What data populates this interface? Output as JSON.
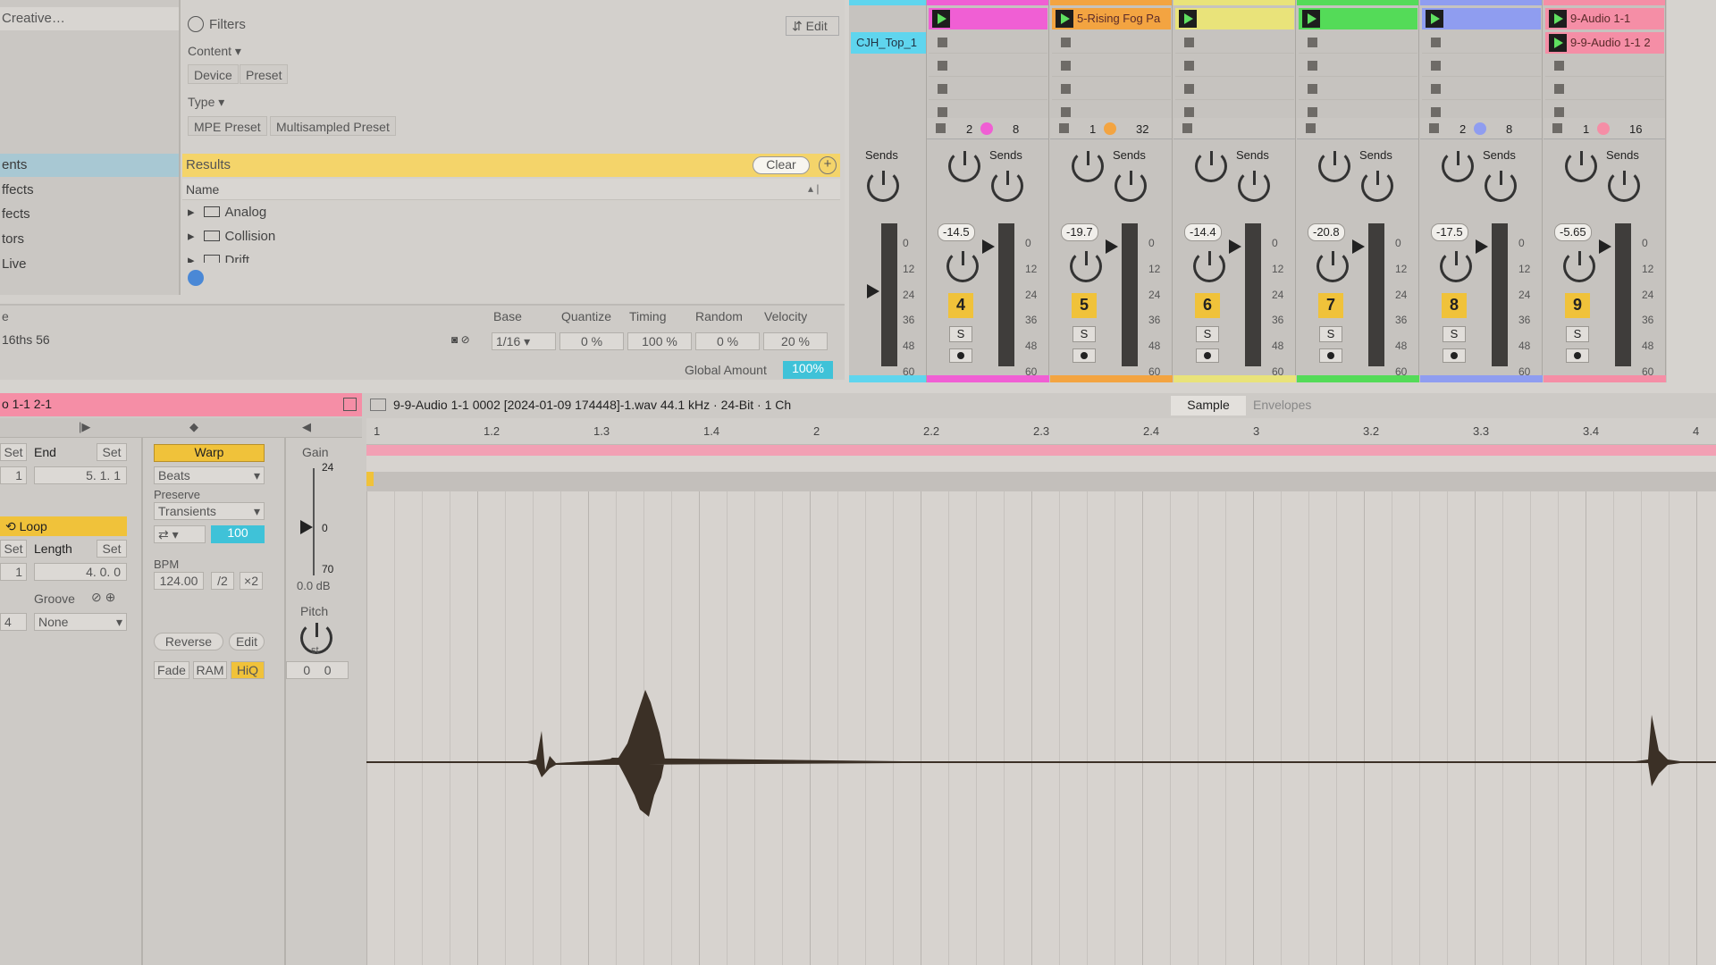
{
  "browser": {
    "sidebar_items": [
      "Creative…",
      "ents",
      "ffects",
      "fects",
      "tors",
      "Live"
    ],
    "filters_label": "Filters",
    "edit_label": "Edit",
    "content_label": "Content",
    "type_label": "Type",
    "chips": [
      "Device",
      "Preset",
      "MPE Preset",
      "Multisampled Preset"
    ],
    "results_label": "Results",
    "clear_label": "Clear",
    "name_header": "Name",
    "folders": [
      "Analog",
      "Collision",
      "Drift"
    ]
  },
  "groove": {
    "row_label": "e",
    "groove_name": "16ths 56",
    "headers": [
      "Base",
      "Quantize",
      "Timing",
      "Random",
      "Velocity"
    ],
    "values": [
      "1/16",
      "0 %",
      "100 %",
      "0 %",
      "20 %"
    ],
    "global_label": "Global Amount",
    "global_value": "100%"
  },
  "mixer": {
    "clips": [
      {
        "name": "CJH_Top_1",
        "color": "#5fd5ee"
      },
      {
        "name": "",
        "color": "#f05fd4"
      },
      {
        "name": "5-Rising Fog Pa",
        "color": "#f3a441"
      },
      {
        "name": "",
        "color": "#e9e37a"
      },
      {
        "name": "",
        "color": "#54db58"
      },
      {
        "name": "",
        "color": "#8f9df0"
      },
      {
        "name": "9-Audio 1-1",
        "color": "#f58ea6"
      }
    ],
    "extra_clip": "9-9-Audio 1-1 2",
    "sends_label": "Sends",
    "tracks": [
      {
        "num": "4",
        "vol": "-14.5",
        "a": "2",
        "b": "8",
        "color": "#f05fd4"
      },
      {
        "num": "5",
        "vol": "-19.7",
        "a": "1",
        "b": "32",
        "color": "#f3a441"
      },
      {
        "num": "6",
        "vol": "-14.4",
        "a": "",
        "b": "",
        "color": "#e9e37a"
      },
      {
        "num": "7",
        "vol": "-20.8",
        "a": "",
        "b": "",
        "color": "#54db58"
      },
      {
        "num": "8",
        "vol": "-17.5",
        "a": "2",
        "b": "8",
        "color": "#8f9df0"
      },
      {
        "num": "9",
        "vol": "-5.65",
        "a": "1",
        "b": "16",
        "color": "#f58ea6"
      }
    ],
    "scale": [
      "0",
      "12",
      "24",
      "36",
      "48",
      "60"
    ],
    "solo_label": "S"
  },
  "clipview": {
    "clip_name": "o 1-1 2-1",
    "end_label": "End",
    "set_label": "Set",
    "end_value": "5.  1.  1",
    "start_value": "1",
    "loop_label": "Loop",
    "length_label": "Length",
    "length_value": "4.  0.  0",
    "groove_label": "Groove",
    "groove_value": "None",
    "groove_left": "4",
    "warp_label": "Warp",
    "warp_mode": "Beats",
    "preserve_label": "Preserve",
    "preserve_value": "Transients",
    "preserve_amount": "100",
    "bpm_label": "BPM",
    "bpm_value": "124.00",
    "half_label": "/2",
    "double_label": "×2",
    "reverse_label": "Reverse",
    "edit_label": "Edit",
    "fade_label": "Fade",
    "ram_label": "RAM",
    "hiq_label": "HiQ",
    "gain_label": "Gain",
    "gain_top": "24",
    "gain_zero": "0",
    "gain_bottom": "70",
    "gain_db": "0.0 dB",
    "pitch_label": "Pitch",
    "pitch_unit": "st",
    "pitch_values": [
      "0",
      "0"
    ],
    "file_info": "9-9-Audio 1-1 0002 [2024-01-09 174448]-1.wav  44.1 kHz · 24-Bit · 1 Ch",
    "tab_sample": "Sample",
    "tab_envelopes": "Envelopes",
    "ruler": [
      "1",
      "1.2",
      "1.3",
      "1.4",
      "2",
      "2.2",
      "2.3",
      "2.4",
      "3",
      "3.2",
      "3.3",
      "3.4",
      "4"
    ]
  }
}
